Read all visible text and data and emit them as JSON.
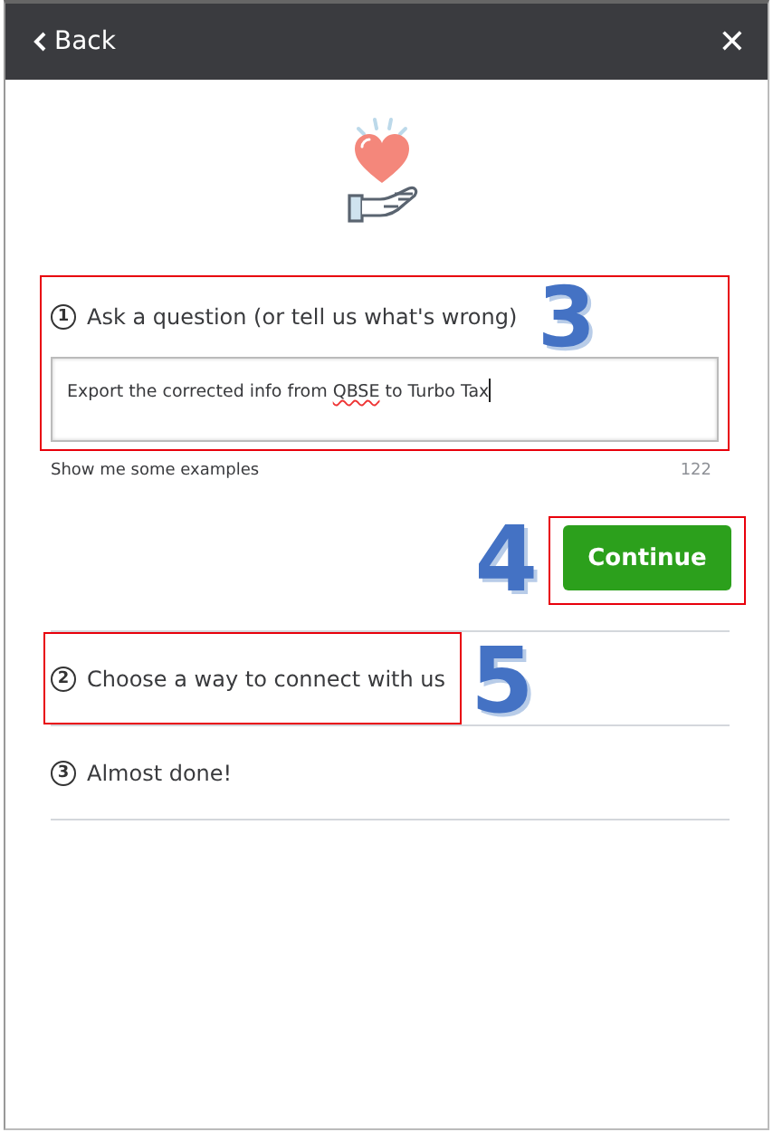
{
  "header": {
    "back_label": "Back",
    "close_label": "✕"
  },
  "steps": [
    {
      "number": "1",
      "title": "Ask a question (or tell us what's wrong)",
      "highlighted": true,
      "annotation": "3",
      "kind": "question",
      "question": {
        "parts": [
          {
            "text": "Export the corrected info from ",
            "misspelled": false
          },
          {
            "text": "QBSE",
            "misspelled": true
          },
          {
            "text": " to Turbo Tax",
            "misspelled": false
          }
        ]
      },
      "examples_link": "Show me some examples",
      "char_count": "122",
      "continue_button": {
        "label": "Continue",
        "highlighted": true,
        "annotation": "4"
      }
    },
    {
      "number": "2",
      "title": "Choose a way to connect with us",
      "highlighted": true,
      "annotation": "5",
      "kind": "collapsed"
    },
    {
      "number": "3",
      "title": "Almost done!",
      "highlighted": false,
      "kind": "collapsed"
    }
  ]
}
